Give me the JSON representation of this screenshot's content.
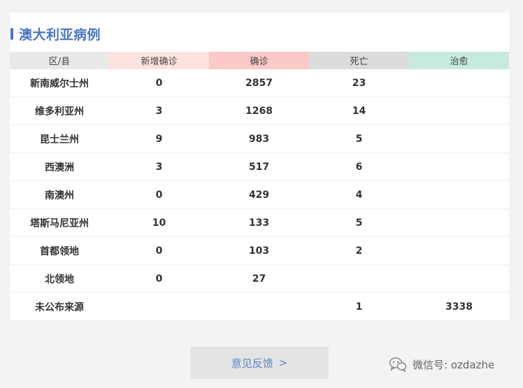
{
  "section": {
    "title": "澳大利亚病例"
  },
  "table": {
    "headers": {
      "region": "区/县",
      "new": "新增确诊",
      "confirmed": "确诊",
      "deaths": "死亡",
      "recovered": "治愈"
    },
    "rows": [
      {
        "region": "新南威尔士州",
        "new": "0",
        "confirmed": "2857",
        "deaths": "23",
        "recovered": ""
      },
      {
        "region": "维多利亚州",
        "new": "3",
        "confirmed": "1268",
        "deaths": "14",
        "recovered": ""
      },
      {
        "region": "昆士兰州",
        "new": "9",
        "confirmed": "983",
        "deaths": "5",
        "recovered": ""
      },
      {
        "region": "西澳洲",
        "new": "3",
        "confirmed": "517",
        "deaths": "6",
        "recovered": ""
      },
      {
        "region": "南澳州",
        "new": "0",
        "confirmed": "429",
        "deaths": "4",
        "recovered": ""
      },
      {
        "region": "塔斯马尼亚州",
        "new": "10",
        "confirmed": "133",
        "deaths": "5",
        "recovered": ""
      },
      {
        "region": "首都领地",
        "new": "0",
        "confirmed": "103",
        "deaths": "2",
        "recovered": ""
      },
      {
        "region": "北领地",
        "new": "0",
        "confirmed": "27",
        "deaths": "",
        "recovered": ""
      },
      {
        "region": "未公布来源",
        "new": "",
        "confirmed": "",
        "deaths": "1",
        "recovered": "3338"
      }
    ]
  },
  "feedback": {
    "label": "意见反馈",
    "chevron": ">"
  },
  "watermark": {
    "text": "微信号: ozdazhe",
    "icon": "wechat-icon"
  },
  "colors": {
    "accent": "#4a76c8",
    "header_region": "#e9e9e9",
    "header_new": "#fde3e0",
    "header_confirmed": "#fbc9c8",
    "header_deaths": "#dcdcdc",
    "header_recovered": "#c6eadf"
  }
}
